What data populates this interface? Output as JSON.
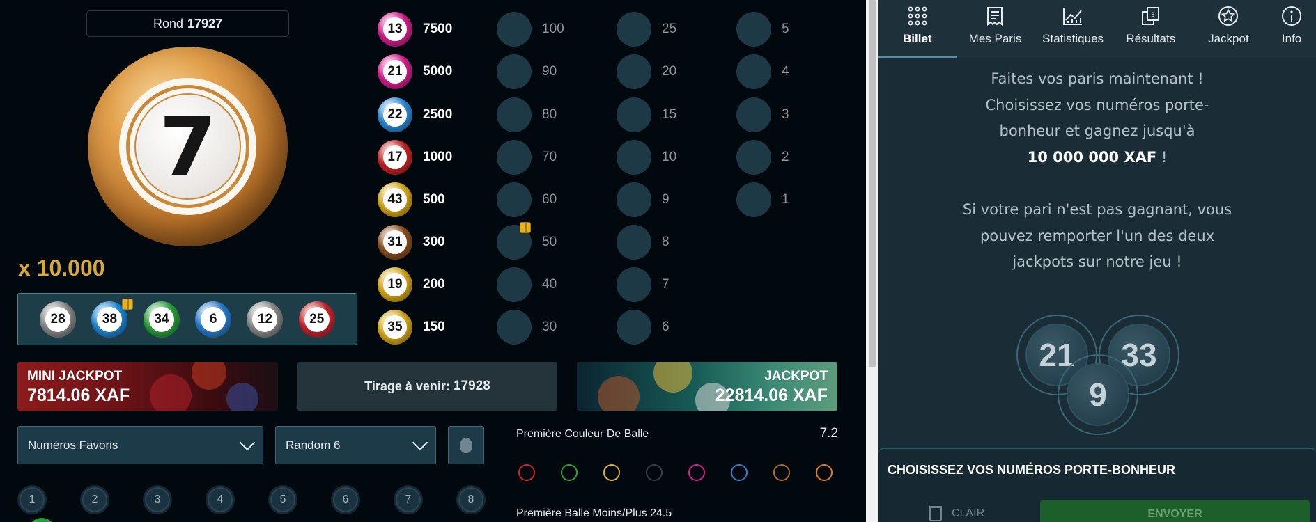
{
  "game": {
    "round_label": "Rond",
    "round_number": "17927",
    "current_ball": "7",
    "multiplier": "x 10.000",
    "last_balls": [
      {
        "n": "28",
        "color": "#8a8a8a",
        "gift": false
      },
      {
        "n": "38",
        "color": "#1e88d8",
        "gift": true
      },
      {
        "n": "34",
        "color": "#2aa33a",
        "gift": false
      },
      {
        "n": "6",
        "color": "#2a7fd0",
        "gift": false
      },
      {
        "n": "12",
        "color": "#8a8a8a",
        "gift": false
      },
      {
        "n": "25",
        "color": "#c9252b",
        "gift": false
      }
    ],
    "payouts": [
      {
        "n": "13",
        "value": "7500",
        "color": "#d81f8f"
      },
      {
        "n": "21",
        "value": "5000",
        "color": "#d81f8f"
      },
      {
        "n": "22",
        "value": "2500",
        "color": "#2a8bd8"
      },
      {
        "n": "17",
        "value": "1000",
        "color": "#c92424"
      },
      {
        "n": "43",
        "value": "500",
        "color": "#d8a91a"
      },
      {
        "n": "31",
        "value": "300",
        "color": "#8c4f1e"
      },
      {
        "n": "19",
        "value": "200",
        "color": "#d8a91a"
      },
      {
        "n": "35",
        "value": "150",
        "color": "#d8a91a"
      }
    ],
    "col1": [
      "100",
      "90",
      "80",
      "70",
      "60",
      "50",
      "40",
      "30"
    ],
    "col2": [
      "25",
      "20",
      "15",
      "10",
      "9",
      "8",
      "7",
      "6"
    ],
    "col3": [
      "5",
      "4",
      "3",
      "2",
      "1"
    ],
    "mini_jackpot_label": "MINI JACKPOT",
    "mini_jackpot_amount": "7814.06 XAF",
    "next_draw_label": "Tirage à venir:",
    "next_draw_number": "17928",
    "jackpot_label": "JACKPOT",
    "jackpot_amount": "22814.06 XAF",
    "favorites_select": "Numéros Favoris",
    "random_select": "Random 6",
    "numbers": [
      "1",
      "2",
      "3",
      "4",
      "5",
      "6",
      "7",
      "8"
    ],
    "first_color_label": "Première Couleur De Balle",
    "first_color_odds": "7.2",
    "first_color_rings": [
      "#c9252b",
      "#2aa33a",
      "#e0b21e",
      "#3a3f44",
      "#d81f8f",
      "#2a7fd0",
      "#b0701e",
      "#e07a1e"
    ],
    "under_over_label": "Première Balle Moins/Plus 24.5"
  },
  "side": {
    "tabs": [
      {
        "label": "Billet",
        "icon": "grid-icon",
        "active": true
      },
      {
        "label": "Mes Paris",
        "icon": "receipt-icon",
        "active": false
      },
      {
        "label": "Statistiques",
        "icon": "chart-icon",
        "active": false
      },
      {
        "label": "Résultats",
        "icon": "results-icon",
        "active": false
      },
      {
        "label": "Jackpot",
        "icon": "star-icon",
        "active": false
      },
      {
        "label": "Info",
        "icon": "info-icon",
        "active": false
      }
    ],
    "promo_line1": "Faites vos paris maintenant !",
    "promo_line2": "Choisissez vos numéros porte-",
    "promo_line3": "bonheur et gagnez jusqu'à",
    "promo_amount": "10 000 000 XAF",
    "promo_amount_suffix": " !",
    "promo_line5": "Si votre pari n'est pas gagnant, vous",
    "promo_line6": "pouvez remporter l'un des deux",
    "promo_line7": "jackpots sur notre jeu !",
    "circle_numbers": [
      "21",
      "33",
      "9"
    ],
    "lucky_title": "CHOISISSEZ VOS NUMÉROS PORTE-BONHEUR",
    "clear_label": "CLAIR",
    "send_label": "ENVOYER"
  }
}
